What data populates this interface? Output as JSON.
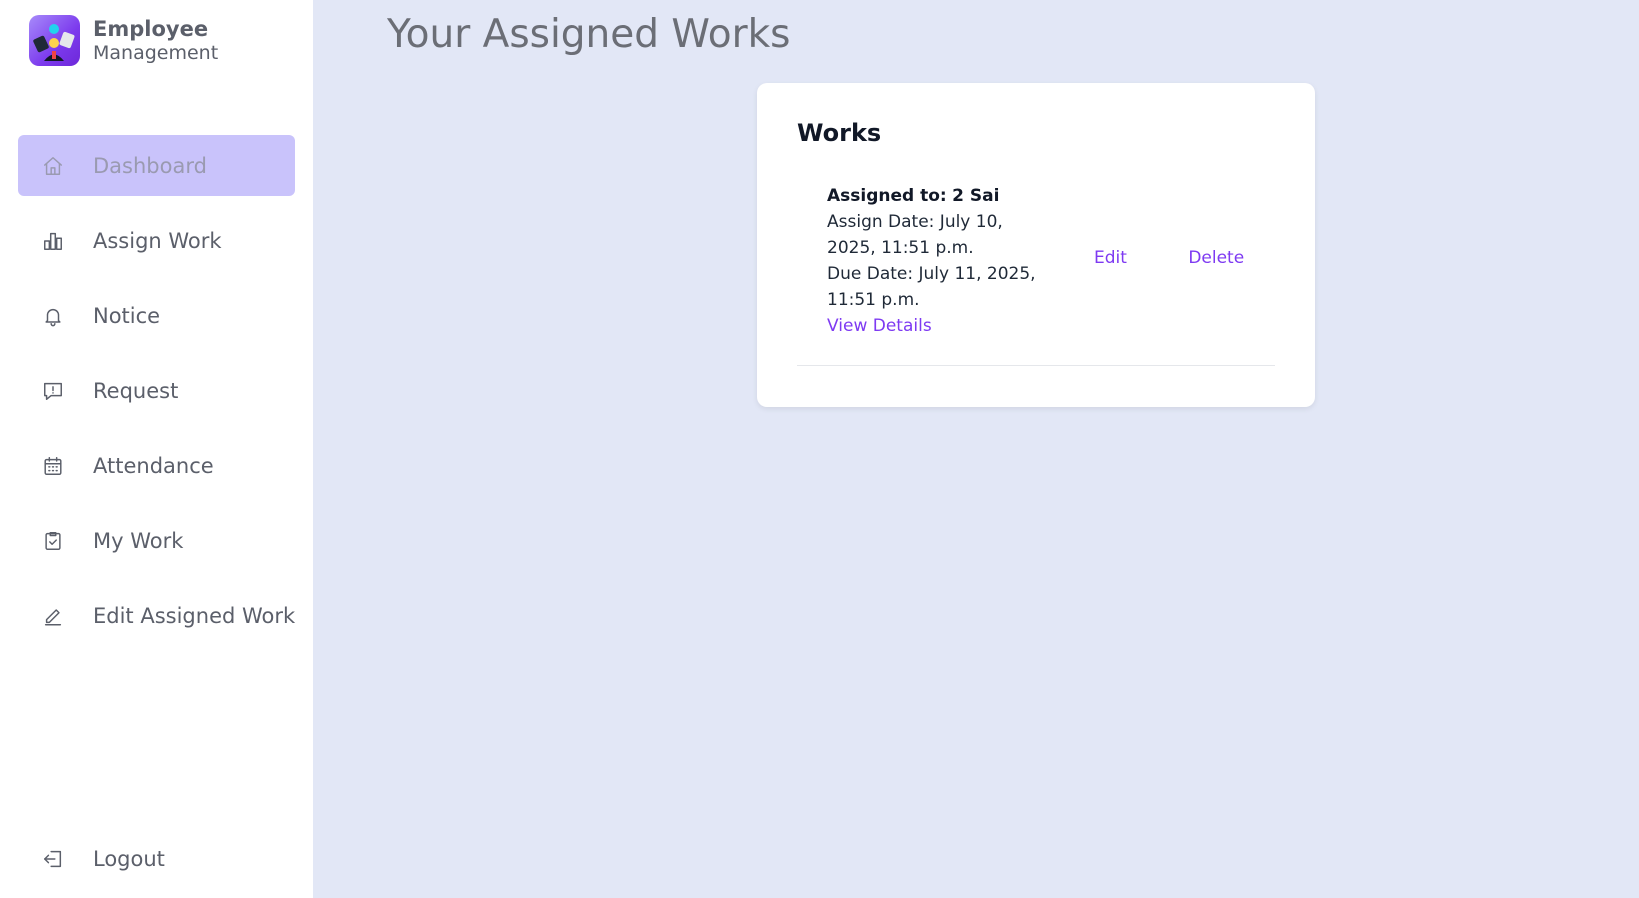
{
  "brand": {
    "title": "Employee",
    "subtitle": "Management"
  },
  "sidebar": {
    "items": [
      {
        "label": "Dashboard",
        "icon": "home-icon",
        "active": true
      },
      {
        "label": "Assign Work",
        "icon": "bar-chart-icon",
        "active": false
      },
      {
        "label": "Notice",
        "icon": "bell-icon",
        "active": false
      },
      {
        "label": "Request",
        "icon": "message-alert-icon",
        "active": false
      },
      {
        "label": "Attendance",
        "icon": "calendar-icon",
        "active": false
      },
      {
        "label": "My Work",
        "icon": "clipboard-check-icon",
        "active": false
      },
      {
        "label": "Edit Assigned Work",
        "icon": "pencil-icon",
        "active": false
      }
    ],
    "logout_label": "Logout"
  },
  "main": {
    "page_title": "Your Assigned Works",
    "card_title": "Works",
    "works": [
      {
        "assigned_label": "Assigned to:",
        "assigned_to": "2 Sai",
        "assign_date": "Assign Date: July 10, 2025, 11:51 p.m.",
        "due_date": "Due Date: July 11, 2025, 11:51 p.m.",
        "view_details": "View Details",
        "edit": "Edit",
        "delete": "Delete"
      }
    ]
  },
  "colors": {
    "background": "#e2e7f6",
    "active_nav": "#c9c3fb",
    "link": "#7e3af2"
  }
}
